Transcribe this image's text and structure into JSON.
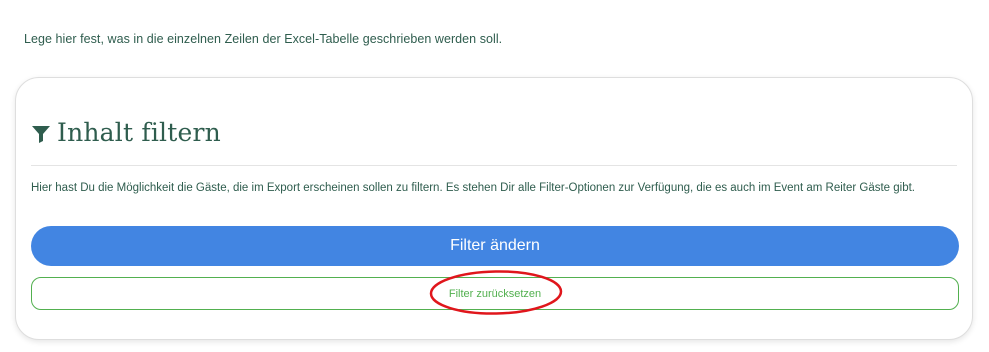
{
  "intro": {
    "text": "Lege hier fest, was in die einzelnen Zeilen der Excel-Tabelle geschrieben werden soll."
  },
  "filter_card": {
    "icon": "filter-funnel-icon",
    "title": "Inhalt filtern",
    "description": "Hier hast Du die Möglichkeit die Gäste, die im Export erscheinen sollen zu filtern. Es stehen Dir alle Filter-Optionen zur Verfügung, die es auch im Event am Reiter Gäste gibt.",
    "change_button_label": "Filter ändern",
    "reset_button_label": "Filter zurücksetzen"
  },
  "colors": {
    "text_green": "#2f5d4e",
    "primary_blue": "#4285e2",
    "outline_green": "#52b04f",
    "annotation_red": "#e0161c"
  }
}
